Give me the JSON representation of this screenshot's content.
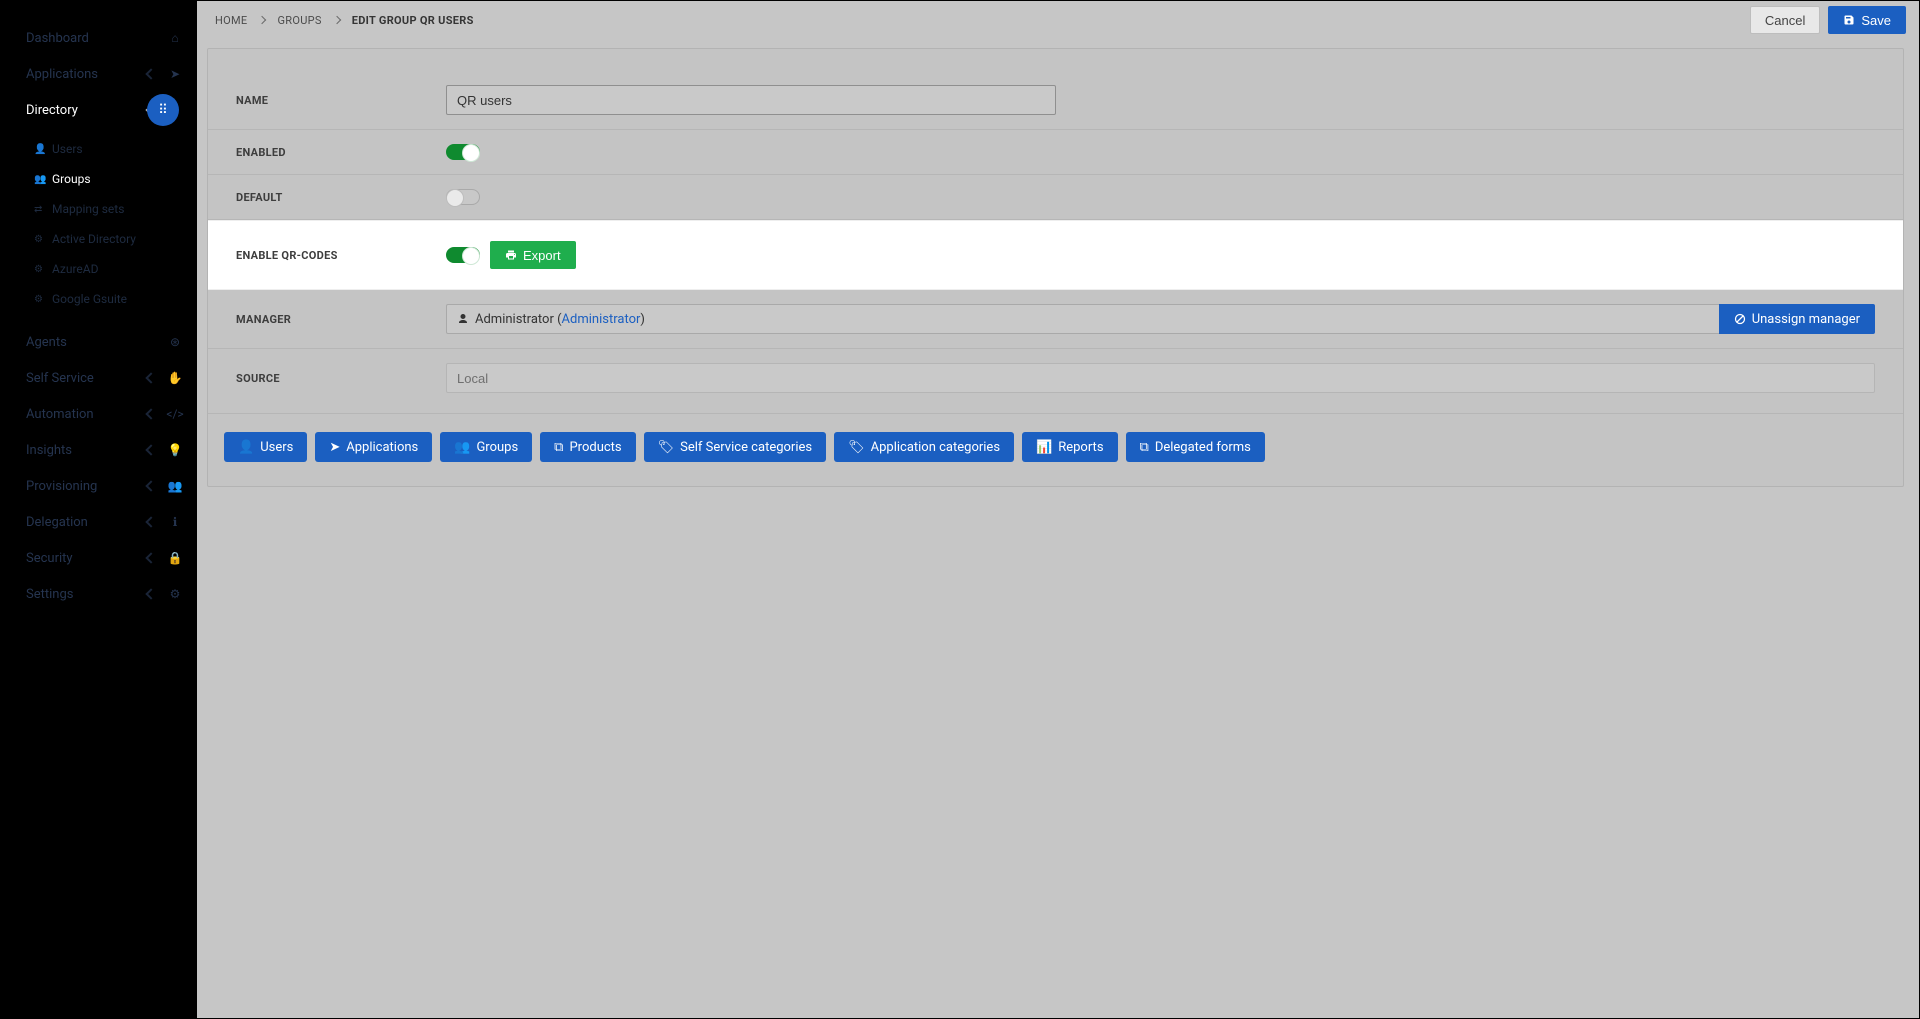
{
  "sidebar": {
    "items": [
      {
        "label": "Dashboard",
        "icon": "home-icon"
      },
      {
        "label": "Applications",
        "icon": "send-icon",
        "expandable": true
      },
      {
        "label": "Directory",
        "icon": "sitemap-icon",
        "expandable": true,
        "active": true,
        "children": [
          {
            "label": "Users",
            "icon": "user-icon"
          },
          {
            "label": "Groups",
            "icon": "users-icon",
            "active": true
          },
          {
            "label": "Mapping sets",
            "icon": "exchange-icon"
          },
          {
            "label": "Active Directory",
            "icon": "gear-icon"
          },
          {
            "label": "AzureAD",
            "icon": "gear-icon"
          },
          {
            "label": "Google Gsuite",
            "icon": "gear-icon"
          }
        ]
      },
      {
        "label": "Agents",
        "icon": "nodes-icon"
      },
      {
        "label": "Self Service",
        "icon": "hand-icon",
        "expandable": true
      },
      {
        "label": "Automation",
        "icon": "code-icon",
        "expandable": true
      },
      {
        "label": "Insights",
        "icon": "bulb-icon",
        "expandable": true
      },
      {
        "label": "Provisioning",
        "icon": "users-icon",
        "expandable": true
      },
      {
        "label": "Delegation",
        "icon": "info-icon",
        "expandable": true
      },
      {
        "label": "Security",
        "icon": "lock-icon",
        "expandable": true
      },
      {
        "label": "Settings",
        "icon": "gear-icon",
        "expandable": true
      }
    ]
  },
  "breadcrumb": {
    "items": [
      "HOME",
      "GROUPS",
      "EDIT GROUP QR USERS"
    ]
  },
  "actions": {
    "cancel": "Cancel",
    "save": "Save"
  },
  "form": {
    "name_label": "Name",
    "name_value": "QR users",
    "enabled_label": "Enabled",
    "enabled_on": true,
    "default_label": "Default",
    "default_on": false,
    "qr_label": "Enable QR-codes",
    "qr_on": true,
    "export_label": "Export",
    "manager_label": "Manager",
    "manager_display_name": "Administrator",
    "manager_link_text": "Administrator",
    "unassign_label": "Unassign manager",
    "source_label": "Source",
    "source_value": "Local"
  },
  "tabs": [
    {
      "label": "Users",
      "icon": "user-icon"
    },
    {
      "label": "Applications",
      "icon": "send-icon"
    },
    {
      "label": "Groups",
      "icon": "users-icon"
    },
    {
      "label": "Products",
      "icon": "cubes-icon"
    },
    {
      "label": "Self Service categories",
      "icon": "tags-icon"
    },
    {
      "label": "Application categories",
      "icon": "tags-icon"
    },
    {
      "label": "Reports",
      "icon": "chart-icon"
    },
    {
      "label": "Delegated forms",
      "icon": "copy-icon"
    }
  ]
}
